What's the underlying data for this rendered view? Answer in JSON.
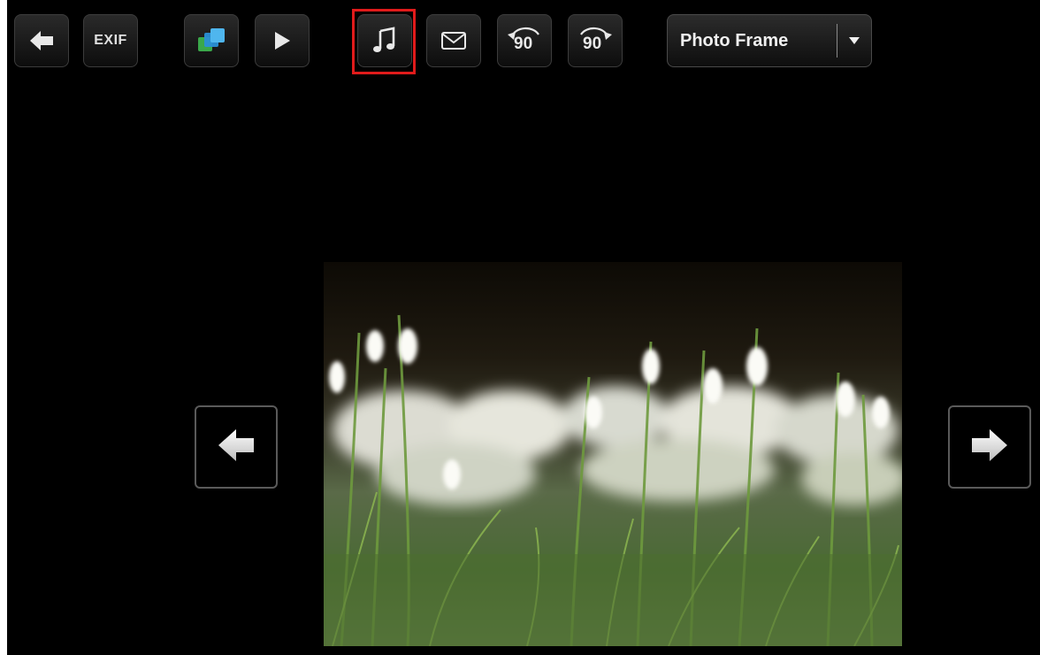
{
  "toolbar": {
    "back": {
      "icon": "arrow-left-icon"
    },
    "exif": {
      "label": "EXIF"
    },
    "layers": {
      "icon": "layers-icon"
    },
    "play": {
      "icon": "play-icon"
    },
    "music": {
      "icon": "music-note-icon",
      "highlighted": true,
      "highlight_color": "#e01b1b"
    },
    "email": {
      "icon": "envelope-icon"
    },
    "rotate_left": {
      "icon": "rotate-left-icon",
      "label": "90"
    },
    "rotate_right": {
      "icon": "rotate-right-icon",
      "label": "90"
    },
    "mode_select": {
      "value": "Photo Frame",
      "icon": "chevron-down-icon"
    }
  },
  "photo": {
    "subject": "snowdrop-flowers-photo"
  },
  "navigation": {
    "previous": {
      "icon": "arrow-left-icon"
    },
    "next": {
      "icon": "arrow-right-icon"
    }
  },
  "colors": {
    "background": "#000000",
    "button": "#1a1a1a",
    "highlight": "#e01b1b"
  }
}
